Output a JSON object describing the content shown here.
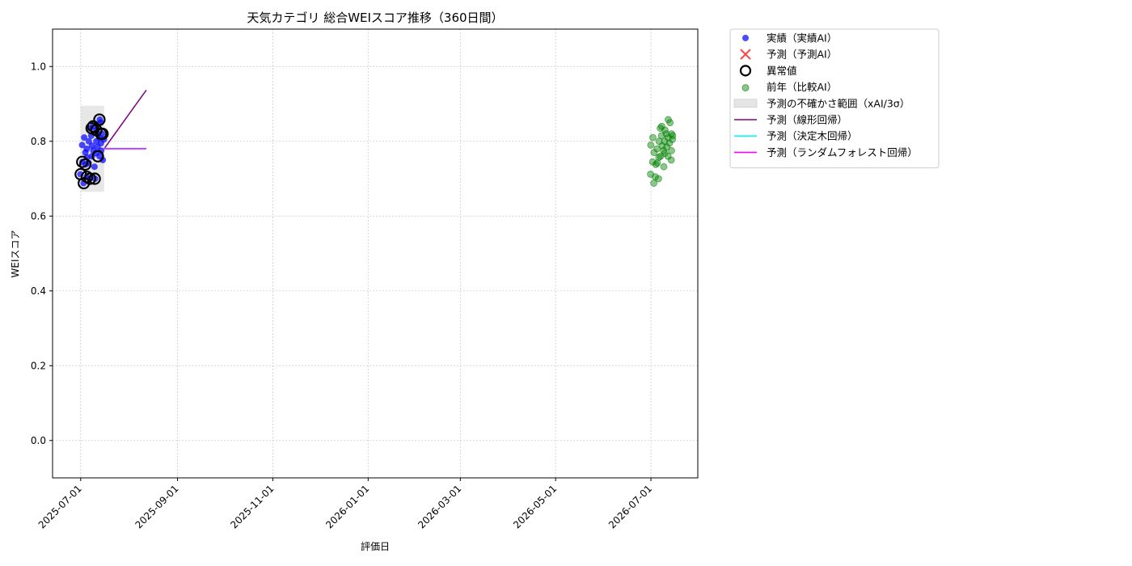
{
  "chart_data": {
    "type": "scatter",
    "title": "天気カテゴリ 総合WEIスコア推移（360日間）",
    "xlabel": "評価日",
    "ylabel": "WEIスコア",
    "xlim": [
      "2025-06-13",
      "2026-07-31"
    ],
    "ylim": [
      -0.1,
      1.1
    ],
    "yticks": [
      "0.0",
      "0.2",
      "0.4",
      "0.6",
      "0.8",
      "1.0"
    ],
    "xticks": [
      "2025-07-01",
      "2025-09-01",
      "2025-11-01",
      "2026-01-01",
      "2026-03-01",
      "2026-05-01",
      "2026-07-01"
    ],
    "grid": true,
    "legend_position": "outside-right-top",
    "colors": {
      "actual": "#0000ff",
      "predicted": "#ff0000",
      "anomaly": "#000000",
      "previous_year": "#008000",
      "uncertainty": "#d3d3d3",
      "linear": "#800080",
      "tree": "#00ffff",
      "forest": "#ff00ff"
    },
    "legend": [
      {
        "key": "actual",
        "label": "実績（実績AI）",
        "marker": "dot"
      },
      {
        "key": "predicted",
        "label": "予測（予測AI）",
        "marker": "x"
      },
      {
        "key": "anomaly",
        "label": "異常値",
        "marker": "ring"
      },
      {
        "key": "previous_year",
        "label": "前年（比較AI）",
        "marker": "dot-faded"
      },
      {
        "key": "uncertainty",
        "label": "予測の不確かさ範囲（xAI/3σ）",
        "marker": "patch"
      },
      {
        "key": "linear",
        "label": "予測（線形回帰）",
        "marker": "line"
      },
      {
        "key": "tree",
        "label": "予測（決定木回帰）",
        "marker": "line"
      },
      {
        "key": "forest",
        "label": "予測（ランダムフォレスト回帰）",
        "marker": "line"
      }
    ],
    "series": [
      {
        "name": "実績（実績AI）",
        "key": "actual",
        "points": [
          [
            "2025-07-01",
            0.712
          ],
          [
            "2025-07-02",
            0.79
          ],
          [
            "2025-07-02",
            0.745
          ],
          [
            "2025-07-03",
            0.81
          ],
          [
            "2025-07-03",
            0.688
          ],
          [
            "2025-07-04",
            0.77
          ],
          [
            "2025-07-04",
            0.738
          ],
          [
            "2025-07-05",
            0.705
          ],
          [
            "2025-07-05",
            0.78
          ],
          [
            "2025-07-06",
            0.742
          ],
          [
            "2025-07-06",
            0.8
          ],
          [
            "2025-07-07",
            0.7
          ],
          [
            "2025-07-07",
            0.835
          ],
          [
            "2025-07-08",
            0.76
          ],
          [
            "2025-07-08",
            0.815
          ],
          [
            "2025-07-09",
            0.84
          ],
          [
            "2025-07-09",
            0.775
          ],
          [
            "2025-07-10",
            0.7
          ],
          [
            "2025-07-10",
            0.732
          ],
          [
            "2025-07-11",
            0.8
          ],
          [
            "2025-07-11",
            0.83
          ],
          [
            "2025-07-12",
            0.785
          ],
          [
            "2025-07-12",
            0.82
          ],
          [
            "2025-07-13",
            0.76
          ],
          [
            "2025-07-13",
            0.858
          ],
          [
            "2025-07-14",
            0.85
          ],
          [
            "2025-07-14",
            0.795
          ],
          [
            "2025-07-15",
            0.75
          ],
          [
            "2025-07-15",
            0.82
          ],
          [
            "2025-07-16",
            0.805
          ],
          [
            "2025-07-05",
            0.757
          ],
          [
            "2025-07-08",
            0.788
          ],
          [
            "2025-07-11",
            0.768
          ],
          [
            "2025-07-13",
            0.81
          ],
          [
            "2025-07-14",
            0.775
          ]
        ]
      },
      {
        "name": "前年（比較AI）",
        "key": "previous_year",
        "points": [
          [
            "2026-07-01",
            0.712
          ],
          [
            "2026-07-01",
            0.79
          ],
          [
            "2026-07-02",
            0.745
          ],
          [
            "2026-07-02",
            0.81
          ],
          [
            "2026-07-03",
            0.688
          ],
          [
            "2026-07-03",
            0.77
          ],
          [
            "2026-07-04",
            0.738
          ],
          [
            "2026-07-04",
            0.705
          ],
          [
            "2026-07-05",
            0.78
          ],
          [
            "2026-07-05",
            0.742
          ],
          [
            "2026-07-06",
            0.8
          ],
          [
            "2026-07-06",
            0.7
          ],
          [
            "2026-07-07",
            0.835
          ],
          [
            "2026-07-07",
            0.76
          ],
          [
            "2026-07-08",
            0.815
          ],
          [
            "2026-07-08",
            0.84
          ],
          [
            "2026-07-09",
            0.775
          ],
          [
            "2026-07-09",
            0.732
          ],
          [
            "2026-07-10",
            0.8
          ],
          [
            "2026-07-10",
            0.83
          ],
          [
            "2026-07-11",
            0.785
          ],
          [
            "2026-07-11",
            0.82
          ],
          [
            "2026-07-12",
            0.76
          ],
          [
            "2026-07-12",
            0.858
          ],
          [
            "2026-07-13",
            0.85
          ],
          [
            "2026-07-13",
            0.795
          ],
          [
            "2026-07-14",
            0.75
          ],
          [
            "2026-07-14",
            0.82
          ],
          [
            "2026-07-15",
            0.805
          ],
          [
            "2026-07-15",
            0.815
          ],
          [
            "2026-07-06",
            0.757
          ],
          [
            "2026-07-08",
            0.788
          ],
          [
            "2026-07-10",
            0.768
          ],
          [
            "2026-07-12",
            0.81
          ],
          [
            "2026-07-14",
            0.775
          ]
        ]
      },
      {
        "name": "異常値",
        "key": "anomaly",
        "points": [
          [
            "2025-07-01",
            0.712
          ],
          [
            "2025-07-02",
            0.745
          ],
          [
            "2025-07-03",
            0.688
          ],
          [
            "2025-07-04",
            0.738
          ],
          [
            "2025-07-05",
            0.705
          ],
          [
            "2025-07-07",
            0.7
          ],
          [
            "2025-07-08",
            0.835
          ],
          [
            "2025-07-09",
            0.84
          ],
          [
            "2025-07-10",
            0.7
          ],
          [
            "2025-07-11",
            0.83
          ],
          [
            "2025-07-12",
            0.76
          ],
          [
            "2025-07-13",
            0.858
          ],
          [
            "2025-07-14",
            0.82
          ],
          [
            "2025-07-15",
            0.82
          ]
        ]
      }
    ],
    "uncertainty_band": {
      "x_start": "2025-07-01",
      "x_end": "2025-07-16",
      "y_low": 0.665,
      "y_high": 0.895
    },
    "prediction_lines": [
      {
        "name": "予測（線形回帰）",
        "key": "linear",
        "points": [
          [
            "2025-07-16",
            0.78
          ],
          [
            "2025-08-12",
            0.937
          ]
        ]
      },
      {
        "name": "予測（決定木回帰）",
        "key": "tree",
        "points": [
          [
            "2025-07-16",
            0.781
          ],
          [
            "2025-08-12",
            0.781
          ]
        ]
      },
      {
        "name": "予測（ランダムフォレスト回帰）",
        "key": "forest",
        "points": [
          [
            "2025-07-16",
            0.78
          ],
          [
            "2025-08-12",
            0.78
          ]
        ]
      }
    ]
  }
}
